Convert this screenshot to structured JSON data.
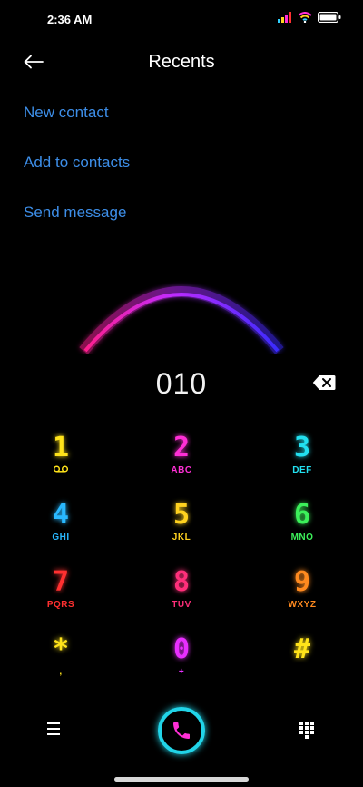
{
  "status_bar": {
    "time": "2:36 AM",
    "icons": [
      "signal-icon",
      "wifi-icon",
      "battery-icon"
    ]
  },
  "header": {
    "title": "Recents",
    "back_icon": "back-arrow-icon"
  },
  "actions": [
    {
      "label": "New contact"
    },
    {
      "label": "Add to contacts"
    },
    {
      "label": "Send message"
    }
  ],
  "dialer": {
    "number": "010",
    "backspace_icon": "backspace-icon"
  },
  "keypad": [
    {
      "digit": "1",
      "letters": "",
      "color": "#ffe31a"
    },
    {
      "digit": "2",
      "letters": "ABC",
      "color": "#ff2fd6"
    },
    {
      "digit": "3",
      "letters": "DEF",
      "color": "#22e0f0"
    },
    {
      "digit": "4",
      "letters": "GHI",
      "color": "#29b8ff"
    },
    {
      "digit": "5",
      "letters": "JKL",
      "color": "#ffd21f"
    },
    {
      "digit": "6",
      "letters": "MNO",
      "color": "#3cf05a"
    },
    {
      "digit": "7",
      "letters": "PQRS",
      "color": "#ff3030"
    },
    {
      "digit": "8",
      "letters": "TUV",
      "color": "#ff2f7a"
    },
    {
      "digit": "9",
      "letters": "WXYZ",
      "color": "#ff8a1f"
    },
    {
      "digit": "*",
      "letters": ",",
      "color": "#ffe31a"
    },
    {
      "digit": "0",
      "letters": "+",
      "color": "#e82fff"
    },
    {
      "digit": "#",
      "letters": "",
      "color": "#ffe31a"
    }
  ],
  "bottom_bar": {
    "menu_icon": "menu-icon",
    "call_icon": "phone-icon",
    "dialpad_icon": "dialpad-icon"
  },
  "colors": {
    "link": "#3d8ee8",
    "call_ring": "#21d4e8",
    "call_glyph": "#ff2fd6",
    "arc_start": "#ff1f8e",
    "arc_end": "#3a2bff"
  }
}
